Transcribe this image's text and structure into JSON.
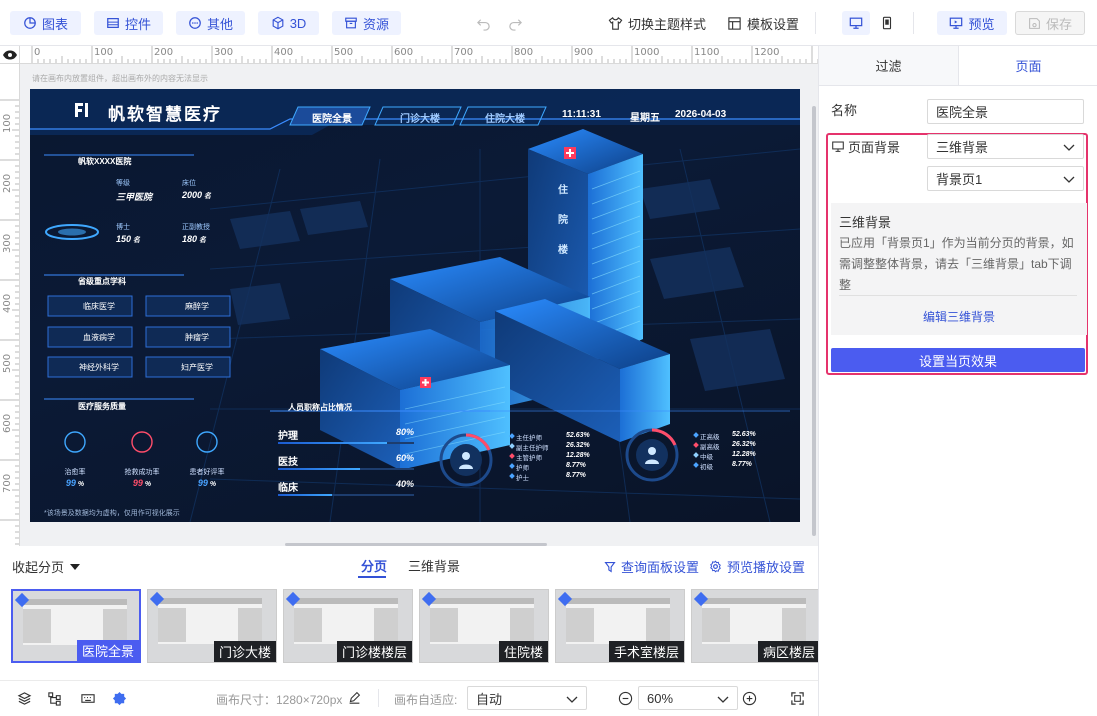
{
  "toolbar": {
    "chart": "图表",
    "widget": "控件",
    "other": "其他",
    "three_d": "3D",
    "resource": "资源",
    "theme": "切换主题样式",
    "template": "模板设置",
    "preview": "预览",
    "save": "保存"
  },
  "canvas": {
    "hint": "请在画布内放置组件，超出画布外的内容无法显示",
    "ruler_h": [
      "0",
      "100",
      "200",
      "300",
      "400",
      "500",
      "600",
      "700",
      "800",
      "900",
      "1000",
      "1100",
      "1200"
    ],
    "ruler_v": [
      "100",
      "200",
      "300",
      "400",
      "500",
      "600",
      "700"
    ]
  },
  "dashboard": {
    "title": "帆软智慧医疗",
    "tabs": [
      "医院全景",
      "门诊大楼",
      "住院大楼"
    ],
    "time": "11:11:31",
    "weekday": "星期五",
    "date": "2026-04-03",
    "hospital_name": "帆软XXXX医院",
    "stats": [
      {
        "label": "等级",
        "value": "三甲医院",
        "unit": ""
      },
      {
        "label": "床位",
        "value": "2000",
        "unit": "名"
      },
      {
        "label": "博士",
        "value": "150",
        "unit": "名"
      },
      {
        "label": "正副教授",
        "value": "180",
        "unit": "名"
      }
    ],
    "building_sign": [
      "住",
      "院",
      "楼"
    ],
    "dept_title": "省级重点学科",
    "depts": [
      "临床医学",
      "麻醉学",
      "血液病学",
      "肿瘤学",
      "神经外科学",
      "妇产医学"
    ],
    "quality_title": "医疗服务质量",
    "quality": [
      {
        "label": "治愈率",
        "value": "99",
        "unit": "%"
      },
      {
        "label": "抢救成功率",
        "value": "99",
        "unit": "%"
      },
      {
        "label": "患者好评率",
        "value": "99",
        "unit": "%"
      }
    ],
    "footnote": "*该场景及数据均为虚构，仅用作可视化展示",
    "staff_title": "人员职称占比情况",
    "staff": [
      {
        "label": "护理",
        "value": "80%",
        "pct": 0.8
      },
      {
        "label": "医技",
        "value": "60%",
        "pct": 0.6
      },
      {
        "label": "临床",
        "value": "40%",
        "pct": 0.4
      }
    ],
    "legend1": [
      {
        "label": "主任护师",
        "value": "52.63%",
        "color": "#4aa3ff"
      },
      {
        "label": "副主任护师",
        "value": "26.32%",
        "color": "#8fd0ff"
      },
      {
        "label": "主管护师",
        "value": "12.28%",
        "color": "#ff4d6a"
      },
      {
        "label": "护师",
        "value": "8.77%",
        "color": "#4aa3ff"
      },
      {
        "label": "护士",
        "value": "8.77%",
        "color": "#4aa3ff"
      }
    ],
    "legend2": [
      {
        "label": "正高级",
        "value": "52.63%",
        "color": "#4aa3ff"
      },
      {
        "label": "副高级",
        "value": "26.32%",
        "color": "#ff4d6a"
      },
      {
        "label": "中级",
        "value": "12.28%",
        "color": "#8fd0ff"
      },
      {
        "label": "初级",
        "value": "8.77%",
        "color": "#4aa3ff"
      }
    ]
  },
  "pagebar": {
    "collapse": "收起分页",
    "tab_pages": "分页",
    "tab_3d": "三维背景",
    "query_settings": "查询面板设置",
    "playback_settings": "预览播放设置",
    "pages": [
      "医院全景",
      "门诊大楼",
      "门诊楼楼层",
      "住院楼",
      "手术室楼层",
      "病区楼层"
    ]
  },
  "bottombar": {
    "canvas_size_label": "画布尺寸：1280×720px",
    "fit_label": "画布自适应:",
    "fit_value": "自动",
    "zoom": "60%"
  },
  "panel": {
    "tab_filter": "过滤",
    "tab_page": "页面",
    "name_label": "名称",
    "name_value": "医院全景",
    "bg_label": "页面背景",
    "bg_type": "三维背景",
    "bg_page": "背景页1",
    "info_title": "三维背景",
    "info_text": "已应用「背景页1」作为当前分页的背景，如需调整整体背景，请去「三维背景」tab下调整",
    "edit_link": "编辑三维背景",
    "apply_button": "设置当页效果"
  },
  "colors": {
    "accent": "#4b5cf0",
    "highlight_border": "#e5336c",
    "dash_bg": "#0a1730"
  }
}
